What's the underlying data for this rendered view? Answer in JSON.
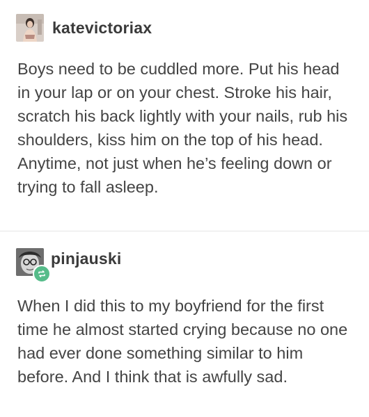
{
  "posts": [
    {
      "username": "katevictoriax",
      "avatar_icon": "user-photo-avatar",
      "text": "Boys need to be cuddled more. Put his head in your lap or on your chest. Stroke his hair, scratch his back lightly with your nails, rub his shoulders, kiss him on the top of his head. Anytime, not just when he’s feeling down or trying to fall asleep."
    },
    {
      "username": "pinjauski",
      "avatar_icon": "user-photo-avatar",
      "badge_icon": "reblog-icon",
      "badge_color": "#56bc8a",
      "text": "When I did this to my boyfriend for the first time he almost started crying because no one had ever done something similar to him before. And I think that is awfully sad."
    }
  ]
}
